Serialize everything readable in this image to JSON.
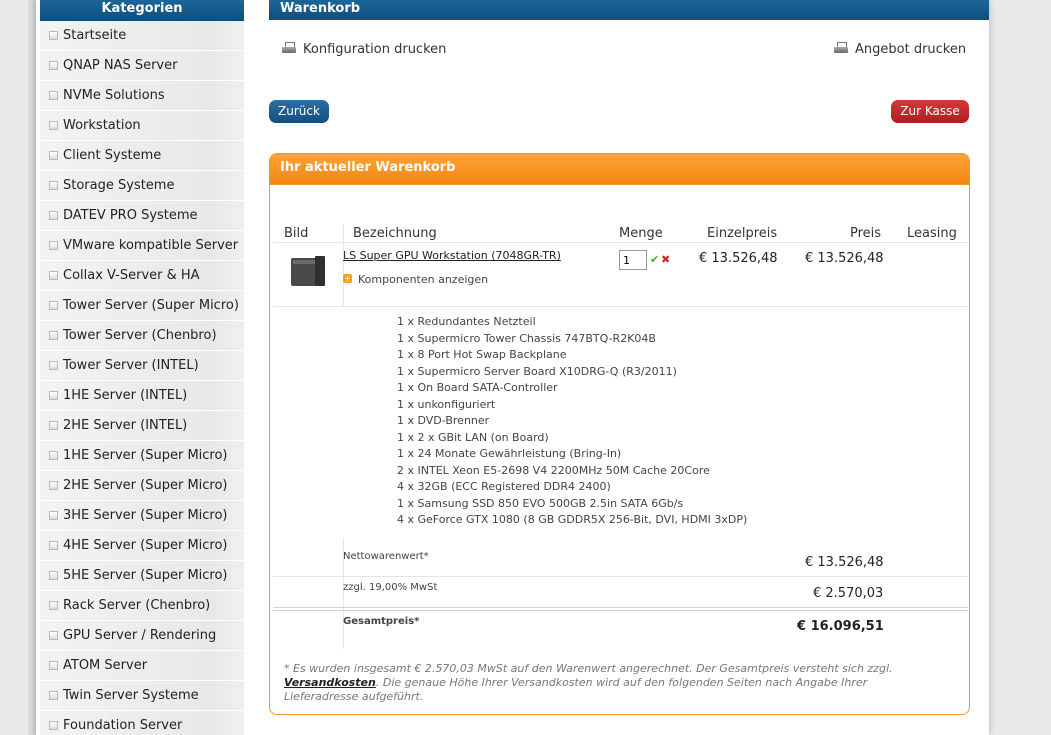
{
  "sidebar": {
    "title": "Kategorien",
    "items": [
      "Startseite",
      "QNAP NAS Server",
      "NVMe Solutions",
      "Workstation",
      "Client Systeme",
      "Storage Systeme",
      "DATEV PRO Systeme",
      "VMware kompatible Server",
      "Collax V-Server & HA",
      "Tower Server (Super Micro)",
      "Tower Server (Chenbro)",
      "Tower Server (INTEL)",
      "1HE Server (INTEL)",
      "2HE Server (INTEL)",
      "1HE Server (Super Micro)",
      "2HE Server (Super Micro)",
      "3HE Server (Super Micro)",
      "4HE Server (Super Micro)",
      "5HE Server (Super Micro)",
      "Rack Server (Chenbro)",
      "GPU Server / Rendering",
      "ATOM Server",
      "Twin Server Systeme",
      "Foundation Server"
    ]
  },
  "main": {
    "title": "Warenkorb",
    "print_config": "Konfiguration drucken",
    "print_offer": "Angebot drucken",
    "back_label": "Zurück",
    "checkout_label": "Zur Kasse"
  },
  "cart": {
    "title": "Ihr aktueller Warenkorb",
    "columns": {
      "image": "Bild",
      "name": "Bezeichnung",
      "qty": "Menge",
      "unit_price": "Einzelpreis",
      "price": "Preis",
      "leasing": "Leasing"
    },
    "item": {
      "name": "LS Super GPU Workstation (7048GR-TR)",
      "qty": "1",
      "unit_price": "€ 13.526,48",
      "price": "€ 13.526,48",
      "components_link": "Komponenten anzeigen",
      "components": [
        "1 x Redundantes Netzteil",
        "1 x Supermicro Tower Chassis 747BTQ-R2K04B",
        "1 x 8 Port Hot Swap Backplane",
        "1 x Supermicro Server Board X10DRG-Q (R3/2011)",
        "1 x On Board SATA-Controller",
        "1 x unkonfiguriert",
        "1 x DVD-Brenner",
        "1 x 2 x GBit LAN (on Board)",
        "1 x 24 Monate Gewährleistung (Bring-In)",
        "2 x INTEL Xeon E5-2698 V4 2200MHz 50M Cache 20Core",
        "4 x 32GB (ECC Registered DDR4 2400)",
        "1 x Samsung SSD 850 EVO 500GB 2.5in SATA 6Gb/s",
        "4 x GeForce GTX 1080 (8 GB GDDR5X 256-Bit, DVI, HDMI 3xDP)"
      ]
    },
    "net_label": "Nettowarenwert*",
    "net_value": "€ 13.526,48",
    "vat_label": "zzgl. 19,00% MwSt",
    "vat_value": "€ 2.570,03",
    "total_label": "Gesamtpreis*",
    "total_value": "€ 16.096,51",
    "footnote_pre": "* Es wurden insgesamt € 2.570,03 MwSt auf den Warenwert angerechnet. Der Gesamtpreis versteht sich zzgl. ",
    "footnote_link": "Versandkosten",
    "footnote_post": ". Die genaue Höhe Ihrer Versandkosten wird auf den folgenden Seiten nach Angabe Ihrer Lieferadresse aufgeführt."
  }
}
